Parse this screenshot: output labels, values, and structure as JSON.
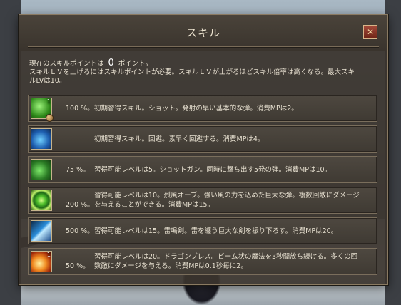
{
  "window": {
    "title": "スキル",
    "close_label": "✕"
  },
  "info": {
    "line1_prefix": "現在のスキルポイントは",
    "points": "0",
    "line1_suffix": "ポイント。",
    "line2": "スキルＬＶを上げるにはスキルポイントが必要。スキルＬＶが上がるほどスキル倍率は高くなる。最大スキ",
    "line3": "ルLVは10。"
  },
  "skills": [
    {
      "icon": "green-shot-icon",
      "level": "1",
      "percent": "100 %。",
      "desc1": "初期習得スキル。ショット。発射の早い基本的な弾。消費MPは2。",
      "desc2": ""
    },
    {
      "icon": "dodge-icon",
      "level": "",
      "percent": "",
      "desc1": "初期習得スキル。回避。素早く回避する。消費MPは4。",
      "desc2": ""
    },
    {
      "icon": "shotgun-icon",
      "level": "",
      "percent": "75 %。",
      "desc1": "習得可能レベルは5。ショットガン。同時に撃ち出す5発の弾。消費MPは10。",
      "desc2": ""
    },
    {
      "icon": "wind-orb-icon",
      "level": "",
      "percent": "200 %。",
      "desc1": "習得可能レベルは10。烈風オーブ。強い風の力を込めた巨大な弾。複数回敵にダメージ",
      "desc2": "を与えることができる。消費MPは15。"
    },
    {
      "icon": "thunder-sword-icon",
      "level": "",
      "percent": "500 %。",
      "desc1": "習得可能レベルは15。雷鳴剣。雷を纏う巨大な剣を振り下ろす。消費MPは20。",
      "desc2": ""
    },
    {
      "icon": "dragon-breath-icon",
      "level": "1",
      "percent": "50 %。",
      "desc1": "習得可能レベルは20。ドラゴンブレス。ビーム状の魔法を3秒間放ち続ける。多くの回",
      "desc2": "数敵にダメージを与える。消費MPは0.1秒毎に2。"
    }
  ]
}
